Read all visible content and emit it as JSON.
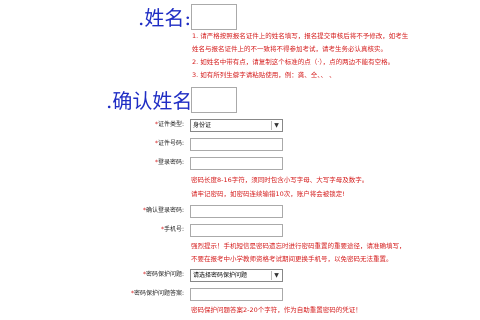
{
  "name_label": ".姓名:",
  "confirm_label": ".确认姓名:",
  "name_notes": [
    "1. 请严格按照报名证件上的姓名填写，报名提交审核后将不予修改，如考生",
    "姓名与报名证件上的不一致将不得参加考试，请考生务必认真核实。",
    "2. 如姓名中带有点，请复制这个标准的点（·），点的两边不能有空格。",
    "3. 如有所列生僻字请粘贴使用，例：龚、仝、、 、"
  ],
  "fields": {
    "id_type": {
      "label": "证件类型:",
      "value": "身份证"
    },
    "id_number": {
      "label": "证件号码:"
    },
    "login_password": {
      "label": "登录密码:"
    },
    "confirm_password": {
      "label": "确认登录密码:"
    },
    "phone": {
      "label": "手机号:"
    },
    "security_question": {
      "label": "密码保护问题:",
      "value": "请选择密码保护问题"
    },
    "security_answer": {
      "label": "密码保护问题答案:"
    }
  },
  "password_notes": [
    "密码长度8-16字符，须同时包含小写字母、大写字母及数字。",
    "请牢记密码，如密码连续输错10次，账户将会被锁定!"
  ],
  "phone_notes": [
    "强烈提示！手机短信是密码遗忘时进行密码重置的重要途径，请准确填写，",
    "不要在报考中小学教师资格考试期间更换手机号，以免密码无法重置。"
  ],
  "answer_note": "密码保护问题答案2-20个字符，作为自助重置密码的凭证！",
  "colors": {
    "label_blue": "#1f2dc4",
    "note_red": "#d41a1a"
  }
}
